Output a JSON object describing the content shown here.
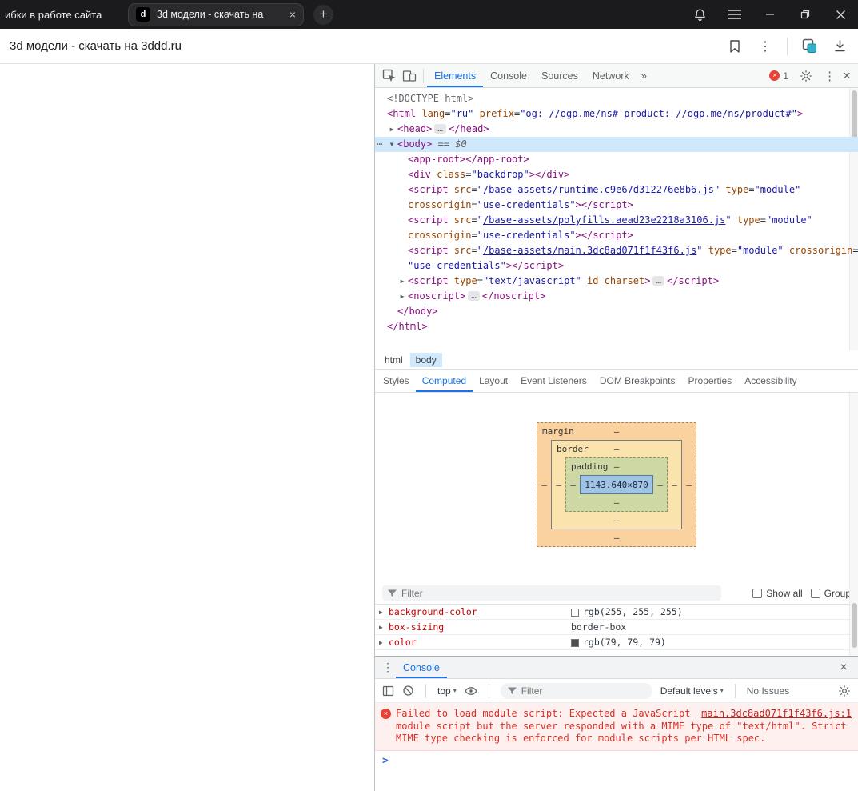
{
  "glyphs": {
    "kebab": "⋮",
    "close": "×",
    "more_tabs": "»",
    "new_tab": "+",
    "caret": "▾",
    "prompt": ">",
    "error_x": "×",
    "tab_close": "×",
    "overflow_dots": "⋯"
  },
  "titlebar": {
    "background_tab_title": "ибки в работе сайта",
    "active_tab_title": "3d модели - скачать на",
    "favicon_letter": "d"
  },
  "toolbar": {
    "page_title": "3d модели - скачать на 3ddd.ru"
  },
  "devtools": {
    "main_tabs": {
      "items": [
        "Elements",
        "Console",
        "Sources",
        "Network"
      ],
      "active": "Elements",
      "error_count": "1"
    },
    "dom_tree": {
      "lines": [
        {
          "ind": 0,
          "toks": [
            [
              "g",
              "<!DOCTYPE html>"
            ]
          ]
        },
        {
          "ind": 0,
          "toks": [
            [
              "t",
              "<html"
            ],
            [
              "a",
              " lang"
            ],
            [
              "p",
              "="
            ],
            [
              "v",
              "\"ru\""
            ],
            [
              "a",
              " prefix"
            ],
            [
              "p",
              "="
            ],
            [
              "v",
              "\"og: //ogp.me/ns# product: //ogp.me/ns/product#\""
            ],
            [
              "t",
              ">"
            ]
          ]
        },
        {
          "ind": 1,
          "arrow": "r",
          "toks": [
            [
              "t",
              "<head>"
            ],
            [
              "e",
              "…"
            ],
            [
              "t",
              "</head>"
            ]
          ]
        },
        {
          "ind": 1,
          "arrow": "d",
          "gut": true,
          "sel": true,
          "toks": [
            [
              "t",
              "<body>"
            ],
            [
              "m",
              " == $0"
            ]
          ]
        },
        {
          "ind": 2,
          "toks": [
            [
              "t",
              "<app-root>"
            ],
            [
              "t",
              "</app-root>"
            ]
          ]
        },
        {
          "ind": 2,
          "toks": [
            [
              "t",
              "<div"
            ],
            [
              "a",
              " class"
            ],
            [
              "p",
              "="
            ],
            [
              "v",
              "\"backdrop\""
            ],
            [
              "t",
              ">"
            ],
            [
              "t",
              "</div>"
            ]
          ]
        },
        {
          "ind": 2,
          "toks": [
            [
              "t",
              "<script"
            ],
            [
              "a",
              " src"
            ],
            [
              "p",
              "="
            ],
            [
              "v",
              "\""
            ],
            [
              "l",
              "/base-assets/runtime.c9e67d312276e8b6.js"
            ],
            [
              "v",
              "\""
            ],
            [
              "a",
              " type"
            ],
            [
              "p",
              "="
            ],
            [
              "v",
              "\"module\""
            ]
          ]
        },
        {
          "ind": 2,
          "toks": [
            [
              "a",
              "crossorigin"
            ],
            [
              "p",
              "="
            ],
            [
              "v",
              "\"use-credentials\""
            ],
            [
              "t",
              ">"
            ],
            [
              "t",
              "</script>"
            ]
          ]
        },
        {
          "ind": 2,
          "toks": [
            [
              "t",
              "<script"
            ],
            [
              "a",
              " src"
            ],
            [
              "p",
              "="
            ],
            [
              "v",
              "\""
            ],
            [
              "l",
              "/base-assets/polyfills.aead23e2218a3106.js"
            ],
            [
              "v",
              "\""
            ],
            [
              "a",
              " type"
            ],
            [
              "p",
              "="
            ],
            [
              "v",
              "\"module\""
            ]
          ]
        },
        {
          "ind": 2,
          "toks": [
            [
              "a",
              "crossorigin"
            ],
            [
              "p",
              "="
            ],
            [
              "v",
              "\"use-credentials\""
            ],
            [
              "t",
              ">"
            ],
            [
              "t",
              "</script>"
            ]
          ]
        },
        {
          "ind": 2,
          "toks": [
            [
              "t",
              "<script"
            ],
            [
              "a",
              " src"
            ],
            [
              "p",
              "="
            ],
            [
              "v",
              "\""
            ],
            [
              "l",
              "/base-assets/main.3dc8ad071f1f43f6.js"
            ],
            [
              "v",
              "\""
            ],
            [
              "a",
              " type"
            ],
            [
              "p",
              "="
            ],
            [
              "v",
              "\"module\""
            ],
            [
              "a",
              " crossorigin"
            ],
            [
              "p",
              "="
            ]
          ]
        },
        {
          "ind": 2,
          "toks": [
            [
              "v",
              "\"use-credentials\""
            ],
            [
              "t",
              ">"
            ],
            [
              "t",
              "</script>"
            ]
          ]
        },
        {
          "ind": 2,
          "arrow": "r",
          "toks": [
            [
              "t",
              "<script"
            ],
            [
              "a",
              " type"
            ],
            [
              "p",
              "="
            ],
            [
              "v",
              "\"text/javascript\""
            ],
            [
              "a",
              " id"
            ],
            [
              "a",
              " charset"
            ],
            [
              "t",
              ">"
            ],
            [
              "e",
              "…"
            ],
            [
              "t",
              "</script>"
            ]
          ]
        },
        {
          "ind": 2,
          "arrow": "r",
          "toks": [
            [
              "t",
              "<noscript>"
            ],
            [
              "e",
              "…"
            ],
            [
              "t",
              "</noscript>"
            ]
          ]
        },
        {
          "ind": 1,
          "toks": [
            [
              "t",
              "</body>"
            ]
          ]
        },
        {
          "ind": 0,
          "toks": [
            [
              "t",
              "</html>"
            ]
          ]
        }
      ]
    },
    "breadcrumbs": {
      "items": [
        "html",
        "body"
      ],
      "active": "body"
    },
    "sidebar_tabs": {
      "items": [
        "Styles",
        "Computed",
        "Layout",
        "Event Listeners",
        "DOM Breakpoints",
        "Properties",
        "Accessibility"
      ],
      "active": "Computed"
    },
    "box_model": {
      "margin_label": "margin",
      "border_label": "border",
      "padding_label": "padding",
      "dash": "–",
      "content_size": "1143.640×870"
    },
    "computed_pane": {
      "filter_placeholder": "Filter",
      "show_all_label": "Show all",
      "group_label": "Group",
      "properties": [
        {
          "name": "background-color",
          "value": "rgb(255, 255, 255)",
          "swatch": "#ffffff"
        },
        {
          "name": "box-sizing",
          "value": "border-box"
        },
        {
          "name": "color",
          "value": "rgb(79, 79, 79)",
          "swatch": "#4f4f4f"
        }
      ]
    },
    "console": {
      "tab_label": "Console",
      "context": "top",
      "filter_placeholder": "Filter",
      "levels_label": "Default levels",
      "issues_label": "No Issues",
      "error": {
        "message": "Failed to load module script: Expected a JavaScript module script but the server responded with a MIME type of \"text/html\". Strict MIME type checking is enforced for module scripts per HTML spec.",
        "source": "main.3dc8ad071f1f43f6.js:1"
      }
    },
    "colors": {
      "accent": "#1a73e8",
      "selection": "#cfe8fc",
      "error_bg": "#fff0f0",
      "error_text": "#d93025"
    }
  }
}
